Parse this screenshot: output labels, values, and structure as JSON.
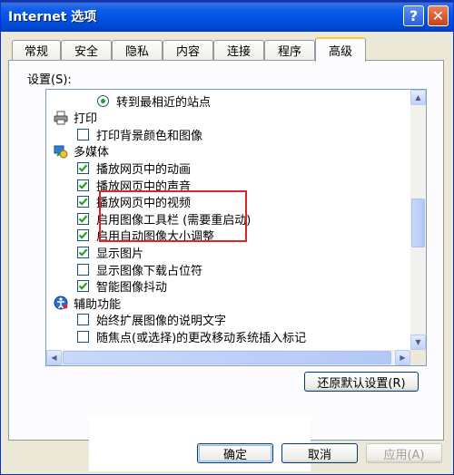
{
  "window": {
    "title": "Internet 选项"
  },
  "titlebar": {
    "help_glyph": "?",
    "close_glyph": "✕"
  },
  "tabs": [
    {
      "label": "常规"
    },
    {
      "label": "安全"
    },
    {
      "label": "隐私"
    },
    {
      "label": "内容"
    },
    {
      "label": "连接"
    },
    {
      "label": "程序"
    },
    {
      "label": "高级",
      "active": true
    }
  ],
  "settings": {
    "label": "设置(S):",
    "items": [
      {
        "type": "radio",
        "label": "转到最相近的站点",
        "checked": true
      },
      {
        "type": "category",
        "label": "打印",
        "icon": "printer-icon"
      },
      {
        "type": "checkbox",
        "label": "打印背景颜色和图像",
        "checked": false
      },
      {
        "type": "category",
        "label": "多媒体",
        "icon": "multimedia-icon"
      },
      {
        "type": "checkbox",
        "label": "播放网页中的动画",
        "checked": true
      },
      {
        "type": "checkbox",
        "label": "播放网页中的声音",
        "checked": true
      },
      {
        "type": "checkbox",
        "label": "播放网页中的视频",
        "checked": true
      },
      {
        "type": "checkbox",
        "label": "启用图像工具栏 (需要重启动)",
        "checked": true
      },
      {
        "type": "checkbox",
        "label": "启用自动图像大小调整",
        "checked": true
      },
      {
        "type": "checkbox",
        "label": "显示图片",
        "checked": true
      },
      {
        "type": "checkbox",
        "label": "显示图像下载占位符",
        "checked": false
      },
      {
        "type": "checkbox",
        "label": "智能图像抖动",
        "checked": true
      },
      {
        "type": "category",
        "label": "辅助功能",
        "icon": "accessibility-icon"
      },
      {
        "type": "checkbox",
        "label": "始终扩展图像的说明文字",
        "checked": false
      },
      {
        "type": "checkbox",
        "label": "随焦点(或选择)的更改移动系统插入标记",
        "checked": false
      }
    ]
  },
  "buttons": {
    "restore_defaults": "还原默认设置(R)",
    "ok": "确定",
    "cancel": "取消",
    "apply": "应用(A)"
  },
  "colors": {
    "titlebar": "#0052e0",
    "check_mark": "#21a121",
    "highlight": "#d8262a"
  }
}
